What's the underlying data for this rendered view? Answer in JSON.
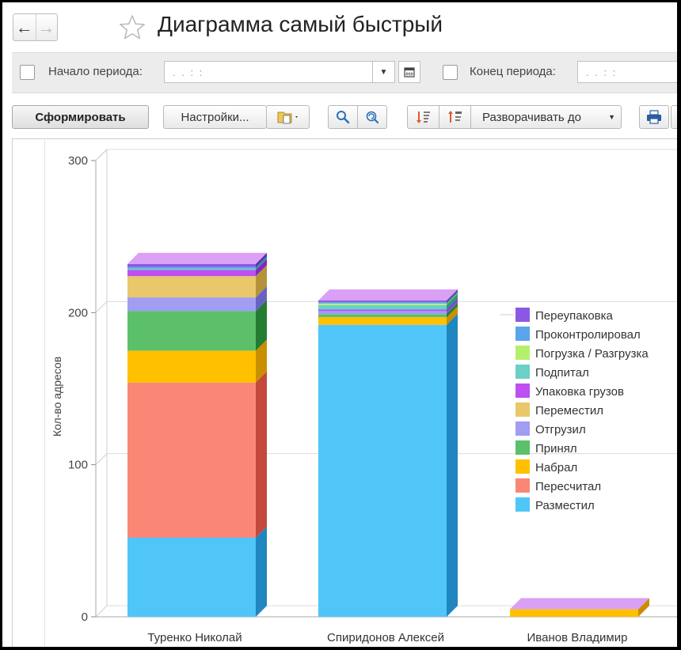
{
  "window": {
    "title": "Диаграмма самый быстрый",
    "back_glyph": "←",
    "forward_glyph": "→",
    "favorite_icon": "star-outline-icon"
  },
  "period": {
    "start_label": "Начало периода:",
    "start_value": ". .   : :",
    "end_label": "Конец периода:",
    "end_value": ". .   : :"
  },
  "toolbar": {
    "generate_label": "Сформировать",
    "settings_label": "Настройки...",
    "expand_label": "Разворачивать до",
    "icons": [
      "variants-icon",
      "search-icon",
      "search-repeat-icon",
      "sort-asc-icon",
      "sort-desc-icon",
      "print-icon"
    ]
  },
  "chart_data": {
    "type": "bar",
    "stacked": true,
    "three_d": true,
    "categories": [
      "Туренко Николай",
      "Спиридонов Алексей",
      "Иванов Владимир"
    ],
    "ylabel": "Кол-во адресов",
    "ylim": [
      0,
      300
    ],
    "yticks": [
      0,
      100,
      200,
      300
    ],
    "legend_position": "right",
    "series": [
      {
        "name": "Размеcтил",
        "color": "#4fc6f7",
        "side": "#1f86c0",
        "values": [
          52,
          192,
          0
        ]
      },
      {
        "name": "Пересчитал",
        "color": "#fa8776",
        "side": "#c4483b",
        "values": [
          102,
          0,
          0
        ]
      },
      {
        "name": "Набрал",
        "color": "#ffc000",
        "side": "#c89000",
        "values": [
          21,
          5,
          5
        ]
      },
      {
        "name": "Принял",
        "color": "#5cbf6a",
        "side": "#237c32",
        "values": [
          26,
          2,
          0
        ]
      },
      {
        "name": "Отгрузил",
        "color": "#a09df3",
        "side": "#6863c3",
        "values": [
          9,
          2,
          0
        ]
      },
      {
        "name": "Переместил",
        "color": "#e8c86a",
        "side": "#b4923a",
        "values": [
          14,
          0,
          0
        ]
      },
      {
        "name": "Упаковка грузов",
        "color": "#bd4ff3",
        "side": "#8525c0",
        "values": [
          4,
          1,
          0
        ]
      },
      {
        "name": "Подпитал",
        "color": "#6bd0c7",
        "side": "#2e948b",
        "values": [
          1,
          3,
          0
        ]
      },
      {
        "name": "Погрузка / Разгрузка",
        "color": "#b4f06c",
        "side": "#74b82f",
        "values": [
          0,
          1,
          0
        ]
      },
      {
        "name": "Проконтролировал",
        "color": "#59a5ec",
        "side": "#2c6fb5",
        "values": [
          1,
          1,
          0
        ]
      },
      {
        "name": "Переупаковка",
        "color": "#8b58e6",
        "side": "#5a2cb5",
        "values": [
          2,
          1,
          0
        ]
      }
    ]
  }
}
